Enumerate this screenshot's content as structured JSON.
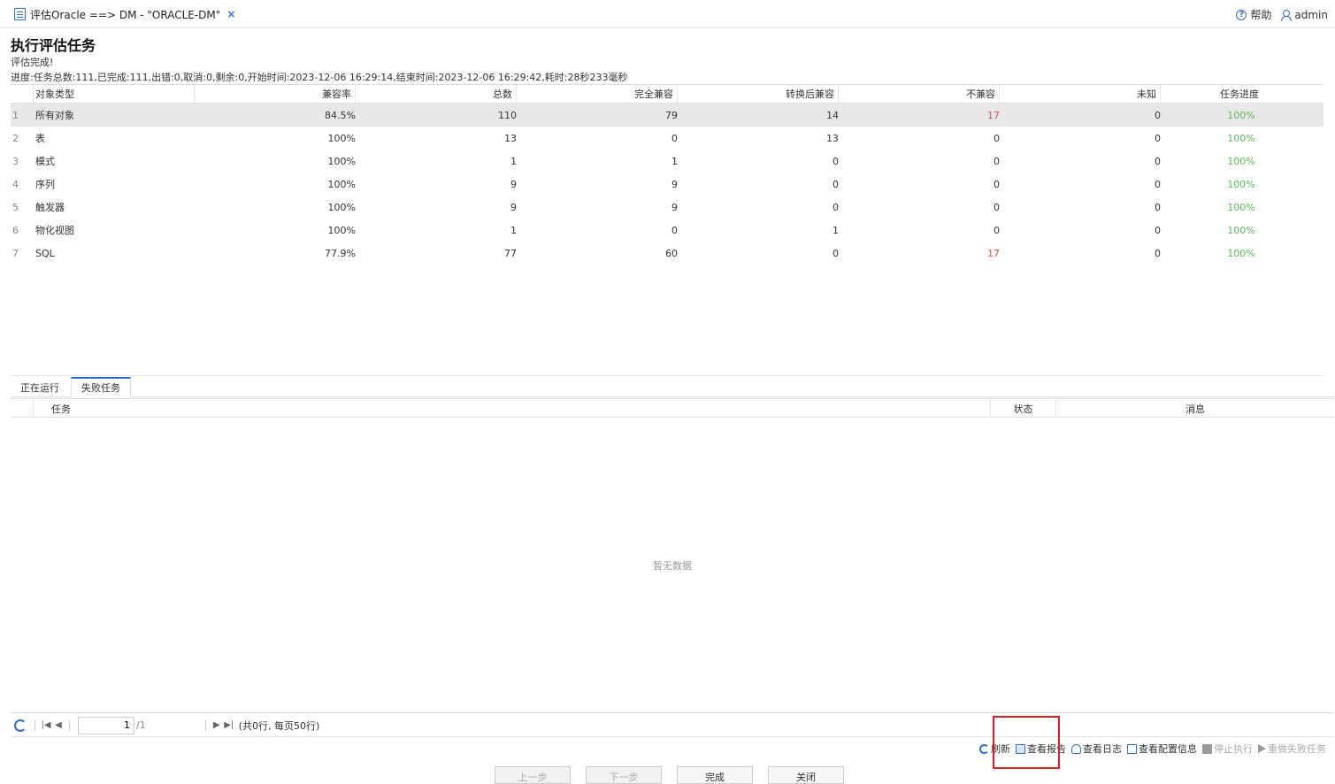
{
  "tab": {
    "title": "评估Oracle ==> DM - \"ORACLE-DM\"",
    "close": "×"
  },
  "top_right": {
    "help": "帮助",
    "user": "admin"
  },
  "heading": "执行评估任务",
  "status": "评估完成!",
  "progress": "进度:任务总数:111,已完成:111,出错:0,取消:0,剩余:0,开始时间:2023-12-06 16:29:14,结束时间:2023-12-06 16:29:42,耗时:28秒233毫秒",
  "summary": {
    "columns": [
      "对象类型",
      "兼容率",
      "总数",
      "完全兼容",
      "转换后兼容",
      "不兼容",
      "未知",
      "任务进度"
    ],
    "rows": [
      {
        "idx": "1",
        "type": "所有对象",
        "rate": "84.5%",
        "total": "110",
        "full": "79",
        "conv": "14",
        "incomp": "17",
        "unknown": "0",
        "prog": "100%"
      },
      {
        "idx": "2",
        "type": "表",
        "rate": "100%",
        "total": "13",
        "full": "0",
        "conv": "13",
        "incomp": "0",
        "unknown": "0",
        "prog": "100%"
      },
      {
        "idx": "3",
        "type": "模式",
        "rate": "100%",
        "total": "1",
        "full": "1",
        "conv": "0",
        "incomp": "0",
        "unknown": "0",
        "prog": "100%"
      },
      {
        "idx": "4",
        "type": "序列",
        "rate": "100%",
        "total": "9",
        "full": "9",
        "conv": "0",
        "incomp": "0",
        "unknown": "0",
        "prog": "100%"
      },
      {
        "idx": "5",
        "type": "触发器",
        "rate": "100%",
        "total": "9",
        "full": "9",
        "conv": "0",
        "incomp": "0",
        "unknown": "0",
        "prog": "100%"
      },
      {
        "idx": "6",
        "type": "物化视图",
        "rate": "100%",
        "total": "1",
        "full": "0",
        "conv": "1",
        "incomp": "0",
        "unknown": "0",
        "prog": "100%"
      },
      {
        "idx": "7",
        "type": "SQL",
        "rate": "77.9%",
        "total": "77",
        "full": "60",
        "conv": "0",
        "incomp": "17",
        "unknown": "0",
        "prog": "100%"
      }
    ]
  },
  "bottom_tabs": [
    "正在运行",
    "失败任务"
  ],
  "failed_grid": {
    "columns": [
      "任务",
      "状态",
      "消息"
    ],
    "empty": "暂无数据"
  },
  "pager": {
    "page": "1",
    "total_pages": "/1",
    "info": "(共0行, 每页50行)"
  },
  "toolbar": {
    "refresh": "刷新",
    "view_report": "查看报告",
    "view_log": "查看日志",
    "view_config": "查看配置信息",
    "stop": "停止执行",
    "redo": "重做失败任务"
  },
  "wizard": {
    "prev": "上一步",
    "next": "下一步",
    "finish": "完成",
    "close": "关闭"
  },
  "colors": {
    "accent": "#2b6fd6",
    "danger": "#d9534f",
    "success": "#5cb85c",
    "highlight": "#e02020"
  }
}
